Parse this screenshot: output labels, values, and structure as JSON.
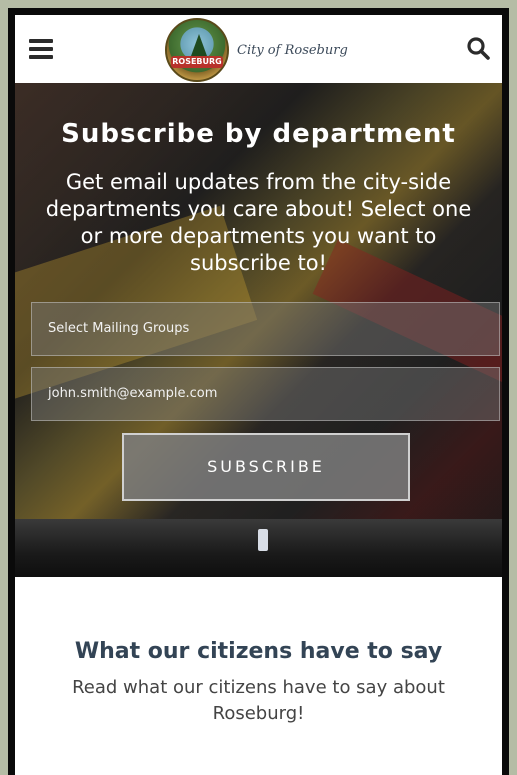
{
  "header": {
    "logo_text": "City of Roseburg",
    "seal_text": "ROSEBURG",
    "icons": {
      "menu": "hamburger-menu-icon",
      "search": "search-icon"
    }
  },
  "subscribe": {
    "title": "Subscribe by department",
    "description": "Get email updates from the city-side departments you care about! Select one or more departments you want to subscribe to!",
    "mailing_groups_value": "Select Mailing Groups",
    "email_value": "john.smith@example.com",
    "button_label": "SUBSCRIBE"
  },
  "testimonials": {
    "title": "What our citizens have to say",
    "description": "Read what our citizens have to say about Roseburg!"
  },
  "colors": {
    "header_bg": "#ffffff",
    "overlay_text": "#ffffff",
    "section_title": "#334455",
    "frame": "#0a0a0a"
  }
}
